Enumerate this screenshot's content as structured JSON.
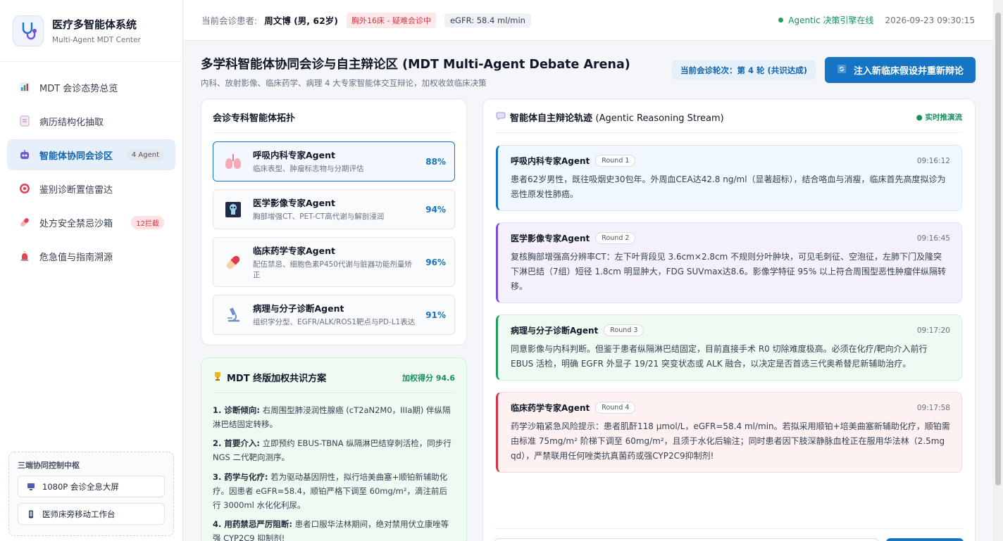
{
  "brand": {
    "title": "医疗多智能体系统",
    "subtitle": "Multi-Agent MDT Center"
  },
  "nav": [
    {
      "label": "MDT 会诊态势总览",
      "badge": ""
    },
    {
      "label": "病历结构化抽取",
      "badge": ""
    },
    {
      "label": "智能体协同会诊区",
      "badge": "4 Agent"
    },
    {
      "label": "鉴别诊断置信雷达",
      "badge": ""
    },
    {
      "label": "处方安全禁忌沙箱",
      "badge": "12拦截"
    },
    {
      "label": "危急值与指南溯源",
      "badge": ""
    }
  ],
  "control": {
    "title": "三端协同控制中枢",
    "buttons": [
      "1080P 会诊全息大屏",
      "医师床旁移动工作台"
    ]
  },
  "header": {
    "patient_label": "当前会诊患者:",
    "patient": "周文博 (男, 62岁)",
    "ward_tag": "胸外16床 - 疑难会诊中",
    "egfr": "eGFR: 58.4 ml/min",
    "engine_status": "Agentic 决策引擎在线",
    "datetime": "2026-09-23 09:30:15"
  },
  "page": {
    "title": "多学科智能体协同会诊与自主辩论区 (MDT Multi-Agent Debate Arena)",
    "subtitle": "内科、放射影像、临床药学、病理 4 大专家智能体交互辩论，加权收敛临床决策",
    "round_pill": "当前会诊轮次：第 4 轮 (共识达成)",
    "inject_button": "注入新临床假设并重新辩论"
  },
  "topology": {
    "title": "会诊专科智能体拓扑",
    "agents": [
      {
        "name": "呼吸内科专家Agent",
        "desc": "临床表型、肿瘤标志物与分期评估",
        "pct": "88%"
      },
      {
        "name": "医学影像专家Agent",
        "desc": "胸部增强CT、PET-CT高代谢与解剖浸润",
        "pct": "94%"
      },
      {
        "name": "临床药学专家Agent",
        "desc": "配伍禁忌、细胞色素P450代谢与脏器功能剂量矫正",
        "pct": "96%"
      },
      {
        "name": "病理与分子诊断Agent",
        "desc": "组织学分型、EGFR/ALK/ROS1靶点与PD-L1表达",
        "pct": "91%"
      }
    ]
  },
  "consensus": {
    "title": "MDT 终版加权共识方案",
    "score": "加权得分 94.6",
    "items": [
      {
        "head": "1. 诊断倾向:",
        "text": "右周围型肺浸润性腺癌 (cT2aN2M0，IIIa期) 伴纵隔淋巴结固定转移。"
      },
      {
        "head": "2. 首要介入:",
        "text": "立即预约 EBUS-TBNA 纵隔淋巴结穿刺活检，同步行 NGS 二代靶向测序。"
      },
      {
        "head": "3. 药学与化疗:",
        "text": "若为驱动基因阴性，拟行培美曲塞+顺铂新辅助化疗。因患者 eGFR=58.4，顺铂严格下调至 60mg/m²，滴注前后行 3000ml 水化化利尿。"
      },
      {
        "head": "4. 用药禁忌严厉阻断:",
        "text": "患者口服华法林期间，绝对禁用伏立康唑等强 CYP2C9 抑制剂!"
      }
    ]
  },
  "stream": {
    "title": "智能体自主辩论轨迹",
    "title_en": "(Agentic Reasoning Stream)",
    "live": "● 实时推演流",
    "messages": [
      {
        "agent": "呼吸内科专家Agent",
        "round": "Round 1",
        "time": "09:16:12",
        "text": "患者62岁男性，既往吸烟史30包年。外周血CEA达42.8 ng/ml（显著超标），结合咯血与消瘦，临床首先高度拟诊为恶性原发性肺癌。"
      },
      {
        "agent": "医学影像专家Agent",
        "round": "Round 2",
        "time": "09:16:45",
        "text": "复核胸部增强高分辨率CT：左下叶背段见 3.6cm×2.8cm 不规则分叶肿块，可见毛刺征、空泡征，左肺下门及隆突下淋巴结（7组）短径 1.8cm 明显肿大，FDG SUVmax达8.6。影像学特征 95% 以上符合周围型恶性肿瘤伴纵隔转移。"
      },
      {
        "agent": "病理与分子诊断Agent",
        "round": "Round 3",
        "time": "09:17:20",
        "text": "同意影像与内科判断。但鉴于患者纵隔淋巴结固定，目前直接手术 R0 切除难度极高。必须在化疗/靶向介入前行 EBUS 活检，明确 EGFR 外显子 19/21 突变状态或 ALK 融合，以决定是否首选三代奥希替尼新辅助治疗。"
      },
      {
        "agent": "临床药学专家Agent",
        "round": "Round 4",
        "time": "09:17:58",
        "text": "药学沙箱紧急风险提示：患者肌酐118 μmol/L，eGFR=58.4 ml/min。若拟采用顺铂+培美曲塞新辅助化疗，顺铂需由标准 75mg/m² 阶梯下调至 60mg/m²，且须于水化后输注；同时患者因下肢深静脉血栓正在服用华法林（2.5mg qd），严禁联用任何唑类抗真菌药或强CYP2C9抑制剂!"
      }
    ]
  },
  "colors": {
    "primary": "#1574c4",
    "success": "#22a05b",
    "danger": "#d6334a",
    "purple": "#7c4ddb"
  }
}
